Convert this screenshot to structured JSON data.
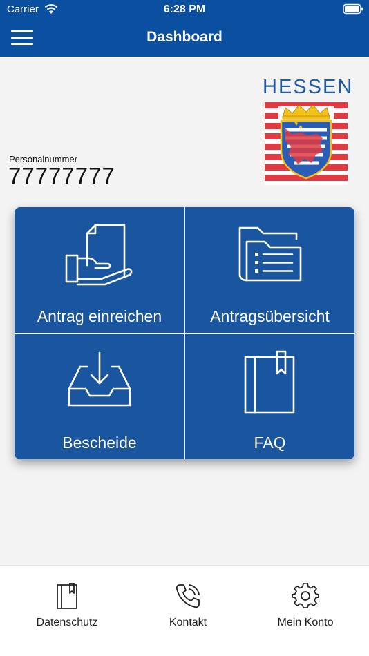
{
  "status_bar": {
    "carrier": "Carrier",
    "time": "6:28 PM",
    "wifi_icon": "wifi-icon",
    "battery_icon": "battery-icon"
  },
  "nav": {
    "title": "Dashboard",
    "menu_icon": "hamburger-menu-icon",
    "background_color": "#0b50a0"
  },
  "logo": {
    "text": "HESSEN",
    "emblem": "hessen-coat-of-arms"
  },
  "personal": {
    "label": "Personalnummer",
    "number": "77777777"
  },
  "tiles": [
    {
      "label": "Antrag einreichen",
      "icon": "hand-document-icon"
    },
    {
      "label": "Antragsübersicht",
      "icon": "folder-list-icon"
    },
    {
      "label": "Bescheide",
      "icon": "inbox-download-icon"
    },
    {
      "label": "FAQ",
      "icon": "book-bookmark-icon"
    }
  ],
  "tile_color": "#1a56a0",
  "tabbar": {
    "items": [
      {
        "label": "Datenschutz",
        "icon": "bookmark-book-icon"
      },
      {
        "label": "Kontakt",
        "icon": "phone-icon"
      },
      {
        "label": "Mein Konto",
        "icon": "gear-icon"
      }
    ]
  }
}
